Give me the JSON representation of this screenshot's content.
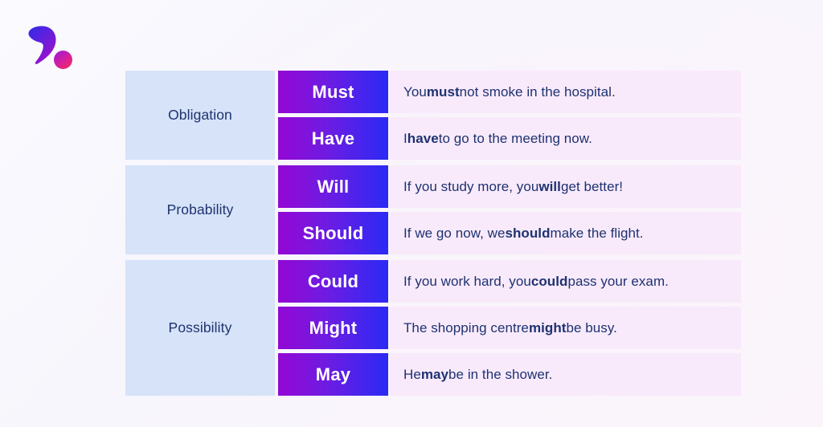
{
  "logo": {
    "name": "comma-logo",
    "comma_gradient_from": "#3a2ae0",
    "comma_gradient_to": "#9a12d0",
    "dot_gradient_from": "#b01ad6",
    "dot_gradient_to": "#f2286b"
  },
  "colors": {
    "category_bg": "#d6e3f8",
    "modal_gradient_from": "#9109d4",
    "modal_gradient_to": "#2a2af5",
    "example_bg": "#f8eafb",
    "text_navy": "#1e3270",
    "modal_text": "#ffffff",
    "page_bg": "#f8f8fc"
  },
  "table": {
    "groups": [
      {
        "category": "Obligation",
        "rows": [
          {
            "modal": "Must",
            "example_full": "You must not smoke in the hospital.",
            "example_before": "You ",
            "example_bold": "must",
            "example_after": " not smoke in the hospital."
          },
          {
            "modal": "Have",
            "example_full": "I have to go to the meeting now.",
            "example_before": "I ",
            "example_bold": "have",
            "example_after": " to go to the meeting now."
          }
        ]
      },
      {
        "category": "Probability",
        "rows": [
          {
            "modal": "Will",
            "example_full": "If you study more, you will get better!",
            "example_before": "If you study more, you ",
            "example_bold": "will",
            "example_after": " get better!"
          },
          {
            "modal": "Should",
            "example_full": "If we go now, we should make the flight.",
            "example_before": "If we go now, we ",
            "example_bold": "should",
            "example_after": " make the flight."
          }
        ]
      },
      {
        "category": "Possibility",
        "rows": [
          {
            "modal": "Could",
            "example_full": "If you work hard, you could pass your exam.",
            "example_before": "If you work hard, you ",
            "example_bold": "could",
            "example_after": " pass your exam."
          },
          {
            "modal": "Might",
            "example_full": "The shopping centre might be busy.",
            "example_before": "The shopping centre ",
            "example_bold": "might",
            "example_after": " be busy."
          },
          {
            "modal": "May",
            "example_full": "He may be in the shower.",
            "example_before": "He ",
            "example_bold": "may",
            "example_after": " be in the shower."
          }
        ]
      }
    ]
  }
}
